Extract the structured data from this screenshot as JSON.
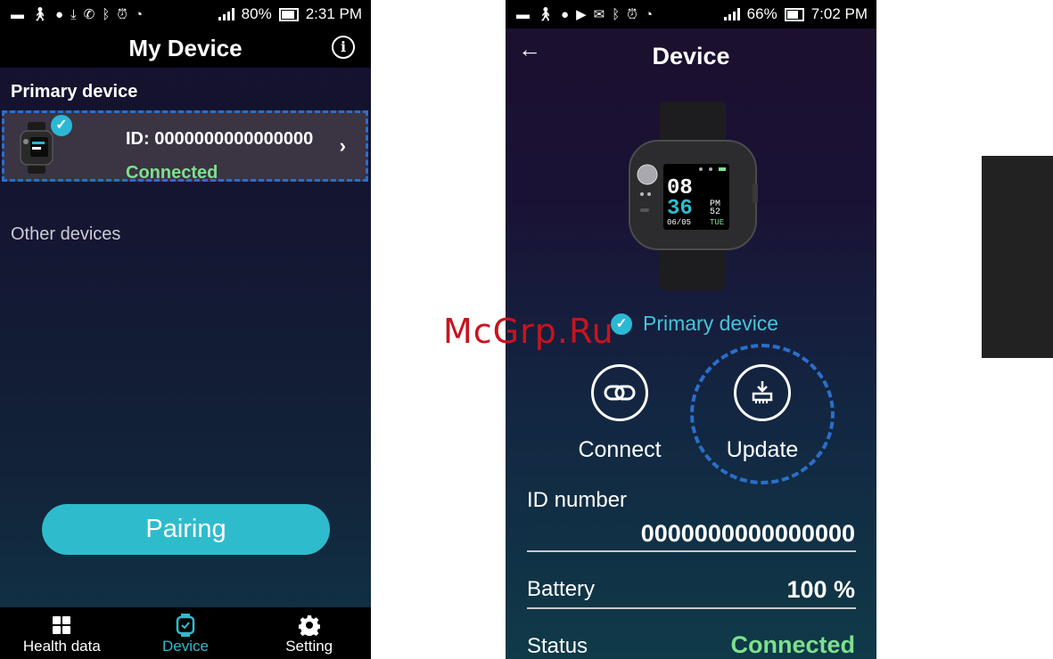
{
  "phone1": {
    "status_bar": {
      "battery": "80%",
      "time": "2:31 PM"
    },
    "title": "My Device",
    "primary_section": "Primary device",
    "device": {
      "id": "ID: 0000000000000000",
      "status": "Connected"
    },
    "other_section": "Other devices",
    "pairing_label": "Pairing",
    "nav": [
      {
        "label": "Health data",
        "icon": "grid-icon"
      },
      {
        "label": "Device",
        "icon": "watch-icon"
      },
      {
        "label": "Setting",
        "icon": "gear-icon"
      }
    ]
  },
  "phone2": {
    "status_bar": {
      "battery": "66%",
      "time": "7:02 PM"
    },
    "title": "Device",
    "watch_screen": {
      "hour": "08",
      "minute": "36",
      "ampm": "PM",
      "seconds": "52",
      "date": "06/05",
      "day": "TUE"
    },
    "primary_label": "Primary device",
    "actions": {
      "connect": "Connect",
      "update": "Update"
    },
    "id_label": "ID number",
    "id_value": "0000000000000000",
    "battery_label": "Battery",
    "battery_value": "100 %",
    "status_label": "Status",
    "status_value": "Connected"
  },
  "watermark": "McGrp.Ru",
  "colors": {
    "accent": "#2ebccd",
    "connected": "#7ee08d",
    "highlight_dash": "#2a6fc9"
  }
}
